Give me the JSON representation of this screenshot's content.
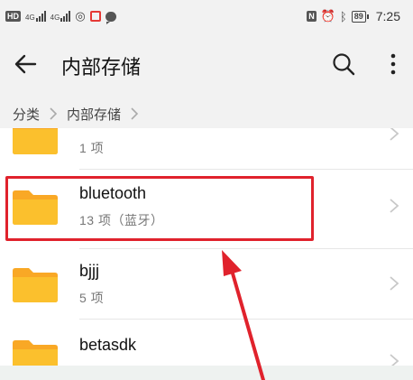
{
  "status_bar": {
    "hd": "HD",
    "net1": "4G",
    "net2": "4G",
    "nfc_tag": "N",
    "battery": "89",
    "time": "7:25"
  },
  "appbar": {
    "title": "内部存储",
    "back_icon": "arrow-left-icon",
    "search_icon": "search-icon",
    "more_icon": "more-vertical-icon"
  },
  "breadcrumb": {
    "items": [
      "分类",
      "内部存储"
    ]
  },
  "files": [
    {
      "name": "",
      "meta": "1 项"
    },
    {
      "name": "bluetooth",
      "meta": "13 项（蓝牙）"
    },
    {
      "name": "bjjj",
      "meta": "5 项"
    },
    {
      "name": "betasdk",
      "meta": ""
    }
  ],
  "colors": {
    "folder": "#fbc02d",
    "folder_tab": "#f9a825",
    "highlight": "#e0222c",
    "arrow": "#e0222c"
  }
}
